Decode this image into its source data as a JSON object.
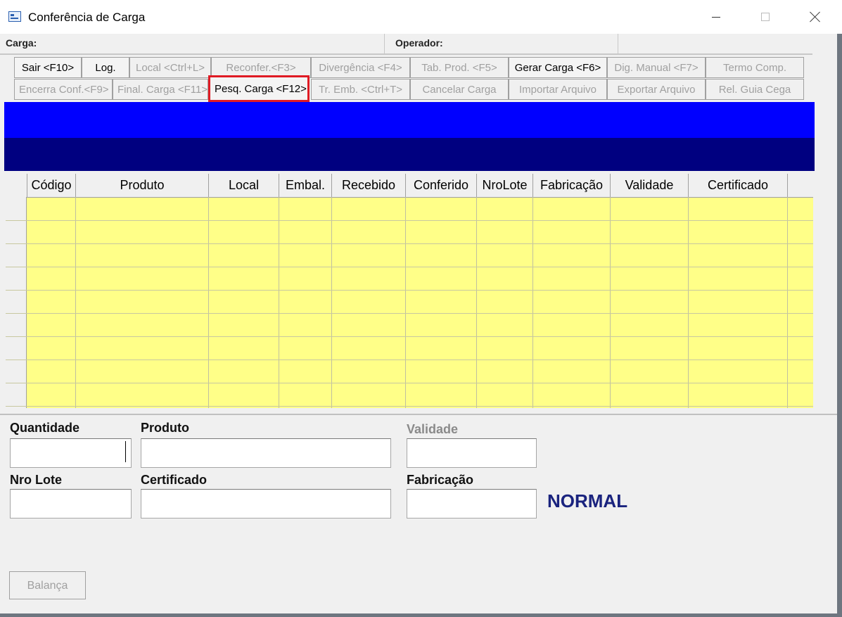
{
  "window": {
    "title": "Conferência de Carga"
  },
  "info_bar": {
    "carga_label": "Carga:",
    "operador_label": "Operador:"
  },
  "toolbar": {
    "row1": [
      {
        "label": "Sair <F10>",
        "enabled": true
      },
      {
        "label": "Log.",
        "enabled": true
      },
      {
        "label": "Local <Ctrl+L>",
        "enabled": false
      },
      {
        "label": "Reconfer.<F3>",
        "enabled": false
      },
      {
        "label": "Divergência <F4>",
        "enabled": false
      },
      {
        "label": "Tab. Prod. <F5>",
        "enabled": false
      },
      {
        "label": "Gerar Carga <F6>",
        "enabled": true
      },
      {
        "label": "Dig. Manual <F7>",
        "enabled": false
      },
      {
        "label": "Termo Comp.",
        "enabled": false
      }
    ],
    "row2": [
      {
        "label": "Encerra Conf.<F9>",
        "enabled": false
      },
      {
        "label": "Final. Carga <F11>",
        "enabled": false
      },
      {
        "label": "Pesq. Carga <F12>",
        "enabled": true
      },
      {
        "label": "Tr. Emb. <Ctrl+T>",
        "enabled": false
      },
      {
        "label": "Cancelar Carga",
        "enabled": false
      },
      {
        "label": "Importar Arquivo",
        "enabled": false
      },
      {
        "label": "Exportar Arquivo",
        "enabled": false
      },
      {
        "label": "Rel. Guia Cega",
        "enabled": false
      }
    ]
  },
  "grid": {
    "columns": [
      "Código",
      "Produto",
      "Local",
      "Embal.",
      "Recebido",
      "Conferido",
      "NroLote",
      "Fabricação",
      "Validade",
      "Certificado"
    ],
    "rows": []
  },
  "form": {
    "quantidade_label": "Quantidade",
    "quantidade_value": "",
    "produto_label": "Produto",
    "produto_value": "",
    "validade_label": "Validade",
    "validade_value": "",
    "nro_lote_label": "Nro Lote",
    "nro_lote_value": "",
    "certificado_label": "Certificado",
    "certificado_value": "",
    "fabricacao_label": "Fabricação",
    "fabricacao_value": "",
    "status": "NORMAL",
    "balanca_label": "Balança"
  },
  "colors": {
    "blue_band": "#0000ff",
    "navy_band": "#000080",
    "grid_background": "#ffff88",
    "highlight_border": "#e01b24",
    "status_text": "#1a237e"
  }
}
